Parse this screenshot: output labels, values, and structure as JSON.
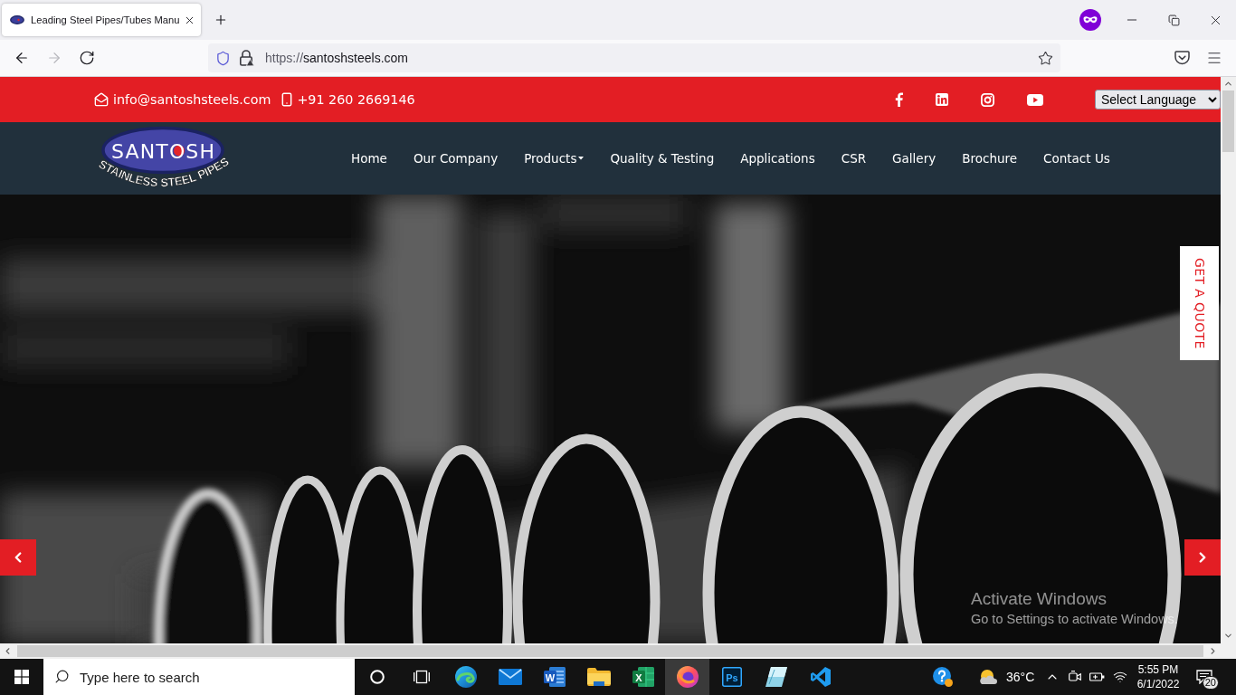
{
  "browser": {
    "tab": {
      "title": "Leading Steel Pipes/Tubes Manu",
      "selected": true
    },
    "nav_buttons": [
      {
        "kind": "back",
        "disabled": false
      },
      {
        "kind": "forward",
        "disabled": true
      },
      {
        "kind": "reload",
        "disabled": false
      }
    ],
    "url": {
      "scheme": "https://",
      "host": "santoshsteels.com"
    }
  },
  "topbar": {
    "email": "info@santoshsteels.com",
    "phone": "+91 260 2669146",
    "social": [
      {
        "kind": "facebook"
      },
      {
        "kind": "linkedin"
      },
      {
        "kind": "instagram"
      },
      {
        "kind": "youtube"
      }
    ],
    "language_select": "Select Language"
  },
  "header": {
    "logo": {
      "name": "SANTOSH",
      "tagline": "STAINLESS STEEL PIPES"
    },
    "nav": [
      {
        "label": "Home",
        "dropdown": false
      },
      {
        "label": "Our Company",
        "dropdown": false
      },
      {
        "label": "Products",
        "dropdown": true
      },
      {
        "label": "Quality & Testing",
        "dropdown": false
      },
      {
        "label": "Applications",
        "dropdown": false
      },
      {
        "label": "CSR",
        "dropdown": false
      },
      {
        "label": "Gallery",
        "dropdown": false
      },
      {
        "label": "Brochure",
        "dropdown": false
      },
      {
        "label": "Contact Us",
        "dropdown": false
      }
    ]
  },
  "hero": {
    "quote_tab": "GET A QUOTE"
  },
  "os_notice": {
    "title": "Activate Windows",
    "text": "Go to Settings to activate Windows."
  },
  "taskbar": {
    "search": {
      "placeholder": "Type here to search"
    },
    "apps": [
      {
        "kind": "cortana",
        "selected": false
      },
      {
        "kind": "task_view",
        "selected": false
      },
      {
        "kind": "edge",
        "selected": false
      },
      {
        "kind": "mail",
        "selected": false
      },
      {
        "kind": "word",
        "glyph": "W",
        "selected": false
      },
      {
        "kind": "explorer",
        "selected": false
      },
      {
        "kind": "excel",
        "glyph": "X",
        "selected": false
      },
      {
        "kind": "firefox",
        "selected": true
      },
      {
        "kind": "photoshop",
        "glyph": "Ps",
        "selected": false
      },
      {
        "kind": "crystal",
        "selected": false
      },
      {
        "kind": "vscode",
        "selected": false
      }
    ],
    "tray": [
      {
        "kind": "help"
      },
      {
        "kind": "weather",
        "text": "36°C"
      },
      {
        "kind": "chevron"
      },
      {
        "kind": "meet"
      },
      {
        "kind": "power"
      },
      {
        "kind": "wifi"
      }
    ],
    "time": "5:55 PM",
    "date": "6/1/2022",
    "notifications": "20"
  }
}
